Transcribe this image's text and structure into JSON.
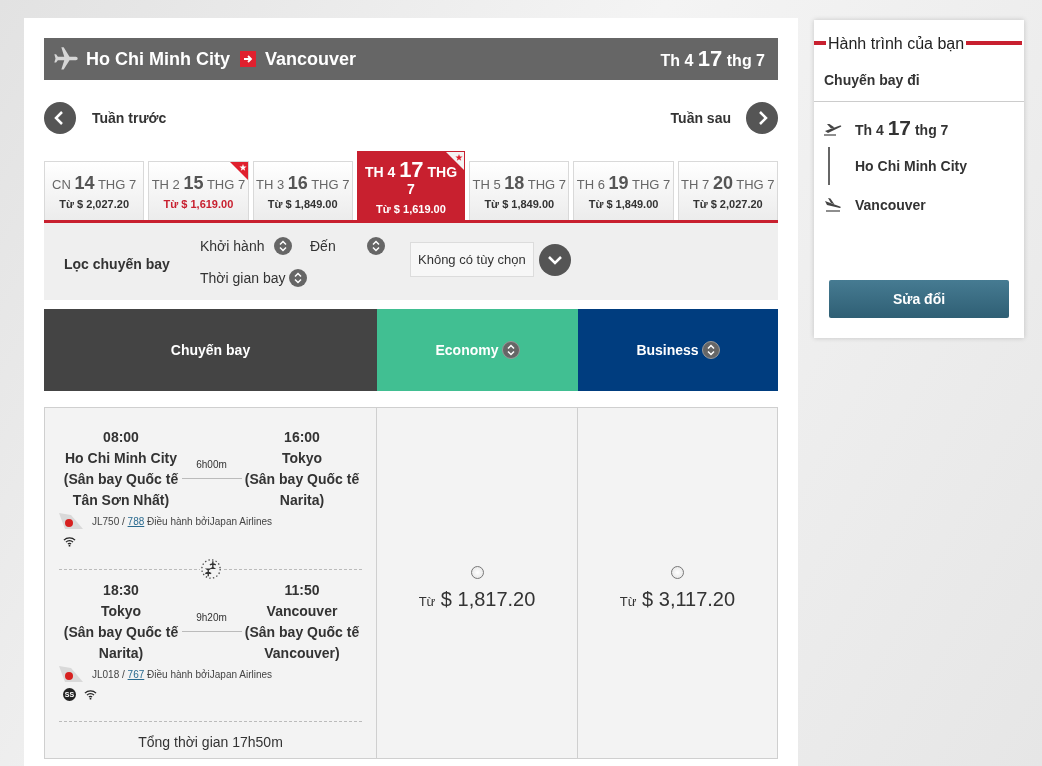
{
  "route_bar": {
    "origin": "Ho Chi Minh City",
    "destination": "Vancouver",
    "date": {
      "weekday": "Th 4",
      "day": "17",
      "month": "thg 7"
    }
  },
  "week_nav": {
    "previous": "Tuần trước",
    "next": "Tuần sau"
  },
  "dates": [
    {
      "weekday": "CN",
      "day": "14",
      "month": "THG 7",
      "price": "Từ $ 2,027.20",
      "lowest": false,
      "selected": false
    },
    {
      "weekday": "TH 2",
      "day": "15",
      "month": "THG 7",
      "price": "Từ $ 1,619.00",
      "lowest": true,
      "selected": false
    },
    {
      "weekday": "TH 3",
      "day": "16",
      "month": "THG 7",
      "price": "Từ $ 1,849.00",
      "lowest": false,
      "selected": false
    },
    {
      "weekday": "TH 4",
      "day": "17",
      "month": "THG 7",
      "price": "Từ $ 1,619.00",
      "lowest": true,
      "selected": true
    },
    {
      "weekday": "TH 5",
      "day": "18",
      "month": "THG 7",
      "price": "Từ $ 1,849.00",
      "lowest": false,
      "selected": false
    },
    {
      "weekday": "TH 6",
      "day": "19",
      "month": "THG 7",
      "price": "Từ $ 1,849.00",
      "lowest": false,
      "selected": false
    },
    {
      "weekday": "TH 7",
      "day": "20",
      "month": "THG 7",
      "price": "Từ $ 2,027.20",
      "lowest": false,
      "selected": false
    }
  ],
  "filter": {
    "label": "Lọc chuyến bay",
    "sort_options": [
      "Khởi hành",
      "Đến",
      "Thời gian bay"
    ],
    "dropdown": {
      "value": "Không có tùy chọn"
    }
  },
  "columns": [
    {
      "label": "Chuyến bay",
      "kind": "flight",
      "sortable": false
    },
    {
      "label": "Economy",
      "kind": "economy",
      "sortable": true
    },
    {
      "label": "Business",
      "kind": "business",
      "sortable": true
    }
  ],
  "flight": {
    "segments": [
      {
        "departure": {
          "time": "08:00",
          "city": "Ho Chi Minh City",
          "airport": "(Sân bay Quốc tế Tân Sơn Nhất)"
        },
        "duration": "6h00m",
        "arrival": {
          "time": "16:00",
          "city": "Tokyo",
          "airport": "(Sân bay Quốc tế Narita)"
        },
        "flight_number": "JL750 /",
        "aircraft": "788",
        "operator": "Điều hành bởiJapan Airlines",
        "amenities": [
          {
            "kind": "wifi"
          }
        ]
      },
      {
        "departure": {
          "time": "18:30",
          "city": "Tokyo",
          "airport": "(Sân bay Quốc tế Narita)"
        },
        "duration": "9h20m",
        "arrival": {
          "time": "11:50",
          "city": "Vancouver",
          "airport": "(Sân bay Quốc tế Vancouver)"
        },
        "flight_number": "JL018 /",
        "aircraft": "767",
        "operator": "Điều hành bởiJapan Airlines",
        "amenities": [
          {
            "kind": "seat",
            "label": "SS"
          },
          {
            "kind": "wifi"
          }
        ]
      }
    ],
    "total": "Tổng thời gian 17h50m",
    "fares": [
      {
        "prefix": "Từ",
        "price": "$ 1,817.20",
        "selected": false
      },
      {
        "prefix": "Từ",
        "price": "$ 3,117.20",
        "selected": false
      }
    ]
  },
  "itinerary": {
    "title": "Hành trình của bạn",
    "subtitle": "Chuyến bay đi",
    "date": {
      "weekday": "Th 4",
      "day": "17",
      "month": "thg 7"
    },
    "origin": "Ho Chi Minh City",
    "destination": "Vancouver",
    "button": "Sửa đổi"
  }
}
